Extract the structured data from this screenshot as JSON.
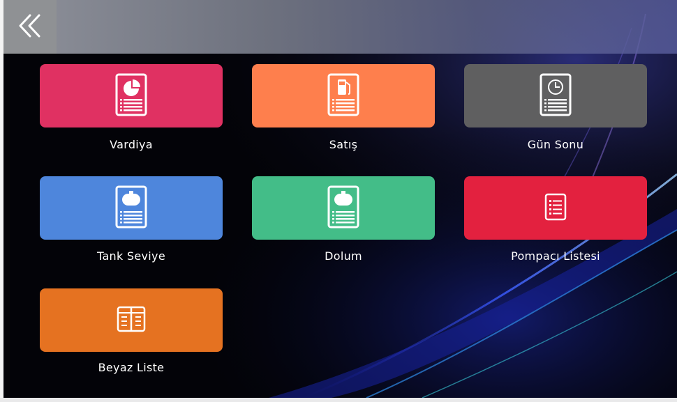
{
  "header": {
    "back_icon": "double-chevron-left-icon"
  },
  "tiles": [
    {
      "label": "Vardiya",
      "color": "#e03162",
      "icon": "report-pie-icon"
    },
    {
      "label": "Satış",
      "color": "#fe7f4d",
      "icon": "report-fuel-pump-icon"
    },
    {
      "label": "Gün Sonu",
      "color": "#5f5f60",
      "icon": "report-clock-icon"
    },
    {
      "label": "Tank Seviye",
      "color": "#4e86dc",
      "icon": "report-tank-icon"
    },
    {
      "label": "Dolum",
      "color": "#43bd88",
      "icon": "report-tank-icon"
    },
    {
      "label": "Pompacı Listesi",
      "color": "#e3213f",
      "icon": "list-icon"
    },
    {
      "label": "Beyaz Liste",
      "color": "#e57221",
      "icon": "book-icon"
    }
  ],
  "colors": {
    "background": "#000000",
    "topbar": "#8f9194",
    "text": "#ffffff"
  }
}
